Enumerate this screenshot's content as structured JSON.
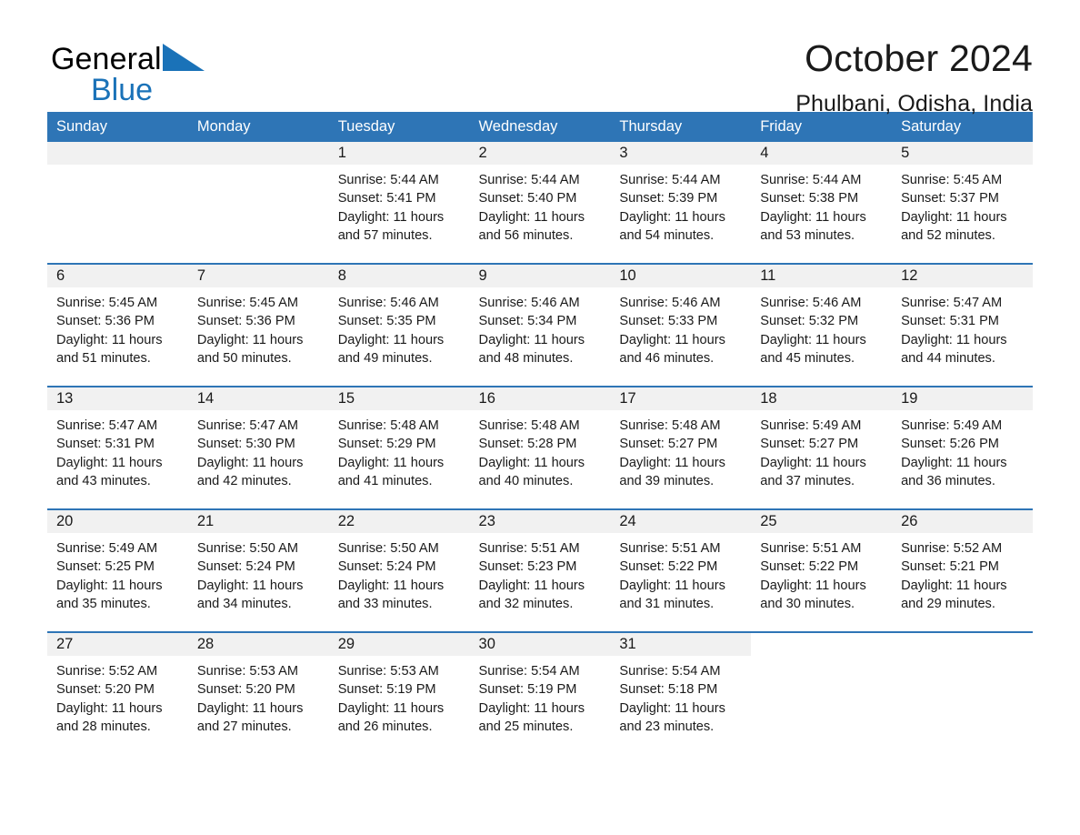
{
  "brand": {
    "name_part1": "General",
    "name_part2": "Blue",
    "flag_icon": "triangle-flag-icon",
    "accent_color": "#1a72b8"
  },
  "header": {
    "title": "October 2024",
    "location": "Phulbani, Odisha, India"
  },
  "theme": {
    "header_blue": "#2e75b6",
    "daynum_gray": "#f1f1f1",
    "text_dark": "#1a1a1a"
  },
  "calendar": {
    "weekday_headers": [
      "Sunday",
      "Monday",
      "Tuesday",
      "Wednesday",
      "Thursday",
      "Friday",
      "Saturday"
    ],
    "weeks": [
      [
        {
          "day": "",
          "blank": true
        },
        {
          "day": "",
          "blank": true
        },
        {
          "day": "1",
          "sunrise": "Sunrise: 5:44 AM",
          "sunset": "Sunset: 5:41 PM",
          "daylight": "Daylight: 11 hours and 57 minutes."
        },
        {
          "day": "2",
          "sunrise": "Sunrise: 5:44 AM",
          "sunset": "Sunset: 5:40 PM",
          "daylight": "Daylight: 11 hours and 56 minutes."
        },
        {
          "day": "3",
          "sunrise": "Sunrise: 5:44 AM",
          "sunset": "Sunset: 5:39 PM",
          "daylight": "Daylight: 11 hours and 54 minutes."
        },
        {
          "day": "4",
          "sunrise": "Sunrise: 5:44 AM",
          "sunset": "Sunset: 5:38 PM",
          "daylight": "Daylight: 11 hours and 53 minutes."
        },
        {
          "day": "5",
          "sunrise": "Sunrise: 5:45 AM",
          "sunset": "Sunset: 5:37 PM",
          "daylight": "Daylight: 11 hours and 52 minutes."
        }
      ],
      [
        {
          "day": "6",
          "sunrise": "Sunrise: 5:45 AM",
          "sunset": "Sunset: 5:36 PM",
          "daylight": "Daylight: 11 hours and 51 minutes."
        },
        {
          "day": "7",
          "sunrise": "Sunrise: 5:45 AM",
          "sunset": "Sunset: 5:36 PM",
          "daylight": "Daylight: 11 hours and 50 minutes."
        },
        {
          "day": "8",
          "sunrise": "Sunrise: 5:46 AM",
          "sunset": "Sunset: 5:35 PM",
          "daylight": "Daylight: 11 hours and 49 minutes."
        },
        {
          "day": "9",
          "sunrise": "Sunrise: 5:46 AM",
          "sunset": "Sunset: 5:34 PM",
          "daylight": "Daylight: 11 hours and 48 minutes."
        },
        {
          "day": "10",
          "sunrise": "Sunrise: 5:46 AM",
          "sunset": "Sunset: 5:33 PM",
          "daylight": "Daylight: 11 hours and 46 minutes."
        },
        {
          "day": "11",
          "sunrise": "Sunrise: 5:46 AM",
          "sunset": "Sunset: 5:32 PM",
          "daylight": "Daylight: 11 hours and 45 minutes."
        },
        {
          "day": "12",
          "sunrise": "Sunrise: 5:47 AM",
          "sunset": "Sunset: 5:31 PM",
          "daylight": "Daylight: 11 hours and 44 minutes."
        }
      ],
      [
        {
          "day": "13",
          "sunrise": "Sunrise: 5:47 AM",
          "sunset": "Sunset: 5:31 PM",
          "daylight": "Daylight: 11 hours and 43 minutes."
        },
        {
          "day": "14",
          "sunrise": "Sunrise: 5:47 AM",
          "sunset": "Sunset: 5:30 PM",
          "daylight": "Daylight: 11 hours and 42 minutes."
        },
        {
          "day": "15",
          "sunrise": "Sunrise: 5:48 AM",
          "sunset": "Sunset: 5:29 PM",
          "daylight": "Daylight: 11 hours and 41 minutes."
        },
        {
          "day": "16",
          "sunrise": "Sunrise: 5:48 AM",
          "sunset": "Sunset: 5:28 PM",
          "daylight": "Daylight: 11 hours and 40 minutes."
        },
        {
          "day": "17",
          "sunrise": "Sunrise: 5:48 AM",
          "sunset": "Sunset: 5:27 PM",
          "daylight": "Daylight: 11 hours and 39 minutes."
        },
        {
          "day": "18",
          "sunrise": "Sunrise: 5:49 AM",
          "sunset": "Sunset: 5:27 PM",
          "daylight": "Daylight: 11 hours and 37 minutes."
        },
        {
          "day": "19",
          "sunrise": "Sunrise: 5:49 AM",
          "sunset": "Sunset: 5:26 PM",
          "daylight": "Daylight: 11 hours and 36 minutes."
        }
      ],
      [
        {
          "day": "20",
          "sunrise": "Sunrise: 5:49 AM",
          "sunset": "Sunset: 5:25 PM",
          "daylight": "Daylight: 11 hours and 35 minutes."
        },
        {
          "day": "21",
          "sunrise": "Sunrise: 5:50 AM",
          "sunset": "Sunset: 5:24 PM",
          "daylight": "Daylight: 11 hours and 34 minutes."
        },
        {
          "day": "22",
          "sunrise": "Sunrise: 5:50 AM",
          "sunset": "Sunset: 5:24 PM",
          "daylight": "Daylight: 11 hours and 33 minutes."
        },
        {
          "day": "23",
          "sunrise": "Sunrise: 5:51 AM",
          "sunset": "Sunset: 5:23 PM",
          "daylight": "Daylight: 11 hours and 32 minutes."
        },
        {
          "day": "24",
          "sunrise": "Sunrise: 5:51 AM",
          "sunset": "Sunset: 5:22 PM",
          "daylight": "Daylight: 11 hours and 31 minutes."
        },
        {
          "day": "25",
          "sunrise": "Sunrise: 5:51 AM",
          "sunset": "Sunset: 5:22 PM",
          "daylight": "Daylight: 11 hours and 30 minutes."
        },
        {
          "day": "26",
          "sunrise": "Sunrise: 5:52 AM",
          "sunset": "Sunset: 5:21 PM",
          "daylight": "Daylight: 11 hours and 29 minutes."
        }
      ],
      [
        {
          "day": "27",
          "sunrise": "Sunrise: 5:52 AM",
          "sunset": "Sunset: 5:20 PM",
          "daylight": "Daylight: 11 hours and 28 minutes."
        },
        {
          "day": "28",
          "sunrise": "Sunrise: 5:53 AM",
          "sunset": "Sunset: 5:20 PM",
          "daylight": "Daylight: 11 hours and 27 minutes."
        },
        {
          "day": "29",
          "sunrise": "Sunrise: 5:53 AM",
          "sunset": "Sunset: 5:19 PM",
          "daylight": "Daylight: 11 hours and 26 minutes."
        },
        {
          "day": "30",
          "sunrise": "Sunrise: 5:54 AM",
          "sunset": "Sunset: 5:19 PM",
          "daylight": "Daylight: 11 hours and 25 minutes."
        },
        {
          "day": "31",
          "sunrise": "Sunrise: 5:54 AM",
          "sunset": "Sunset: 5:18 PM",
          "daylight": "Daylight: 11 hours and 23 minutes."
        },
        {
          "day": "",
          "empty": true
        },
        {
          "day": "",
          "empty": true
        }
      ]
    ]
  }
}
